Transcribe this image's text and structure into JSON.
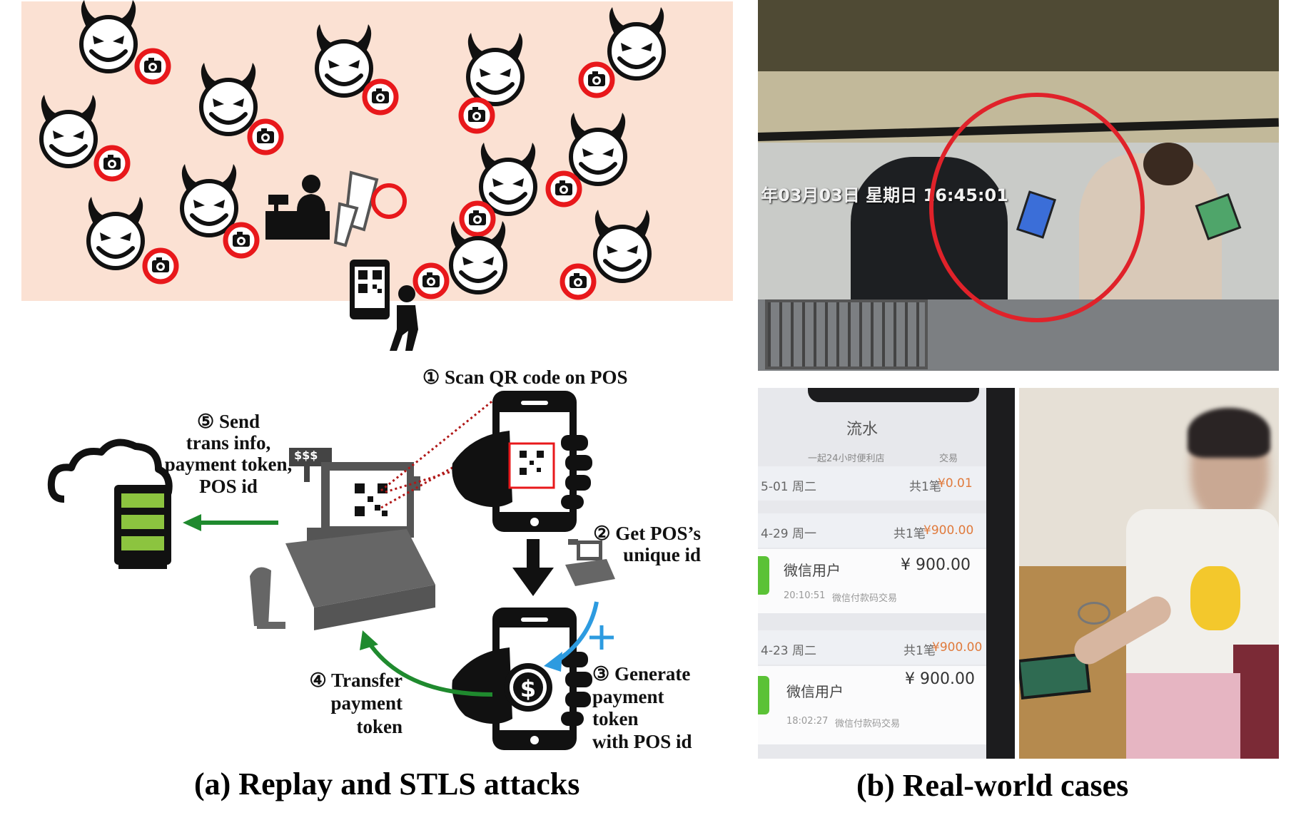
{
  "panel_a": {
    "steps": {
      "s1": "① Scan QR code on POS",
      "s2_line1": "② Get POS’s",
      "s2_line2": "unique id",
      "s3_line1": "③ Generate",
      "s3_line2": "payment",
      "s3_line3": "token",
      "s3_line4": "with POS id",
      "s4_line1": "④ Transfer",
      "s4_line2": "payment",
      "s4_line3": "token",
      "s5_line1": "⑤ Send",
      "s5_line2": "trans info,",
      "s5_line3": "payment token,",
      "s5_line4": "POS id"
    },
    "pos_price_sign": "$$$",
    "caption": "(a) Replay and STLS attacks"
  },
  "panel_b": {
    "cctv_timestamp": "年03月03日 星期日 16:45:01",
    "receipt": {
      "title": "流水",
      "col_header_left": "一起24小时便利店",
      "col_header_right": "交易",
      "rows": [
        {
          "date": "5-01 周二",
          "count": "共1笔",
          "amount": "¥0.01",
          "user": "",
          "time": "",
          "note": "",
          "value": ""
        },
        {
          "date": "4-29 周一",
          "count": "共1笔",
          "amount": "¥900.00",
          "user": "微信用户",
          "time": "20:10:51",
          "note": "微信付款码交易",
          "value": "¥ 900.00"
        },
        {
          "date": "4-23 周二",
          "count": "共1笔",
          "amount": "¥900.00",
          "user": "微信用户",
          "time": "18:02:27",
          "note": "微信付款码交易",
          "value": "¥ 900.00"
        }
      ]
    },
    "caption": "(b) Real-world cases"
  },
  "colors": {
    "panel_bg": "#fbe1d3",
    "camera_red": "#e8181b",
    "arrow_green": "#1f8a2e",
    "arrow_blue": "#2d9be0",
    "server_green": "#8cc43f",
    "cctv_circle": "#e0222a"
  }
}
